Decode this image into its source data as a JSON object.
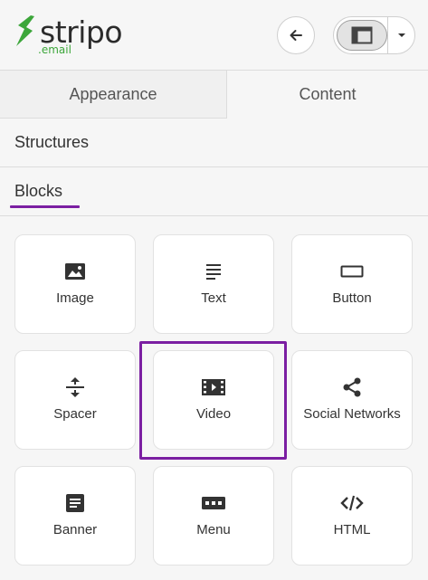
{
  "header": {
    "logo_word": "stripo",
    "logo_sub": ".email",
    "brand_color": "#3ca63a",
    "back_icon": "arrow-left-icon",
    "view_icon": "layout-panel-icon",
    "caret_icon": "caret-down-icon"
  },
  "tabs": [
    {
      "label": "Appearance",
      "active": false
    },
    {
      "label": "Content",
      "active": true
    }
  ],
  "sections": {
    "structures": "Structures",
    "blocks": "Blocks",
    "accent": "#7b1fa2"
  },
  "blocks": [
    {
      "label": "Image",
      "icon": "image-icon"
    },
    {
      "label": "Text",
      "icon": "text-icon"
    },
    {
      "label": "Button",
      "icon": "button-icon"
    },
    {
      "label": "Spacer",
      "icon": "spacer-icon"
    },
    {
      "label": "Video",
      "icon": "video-icon",
      "highlighted": true
    },
    {
      "label": "Social Networks",
      "icon": "share-icon"
    },
    {
      "label": "Banner",
      "icon": "banner-icon"
    },
    {
      "label": "Menu",
      "icon": "menu-icon"
    },
    {
      "label": "HTML",
      "icon": "code-icon"
    }
  ]
}
